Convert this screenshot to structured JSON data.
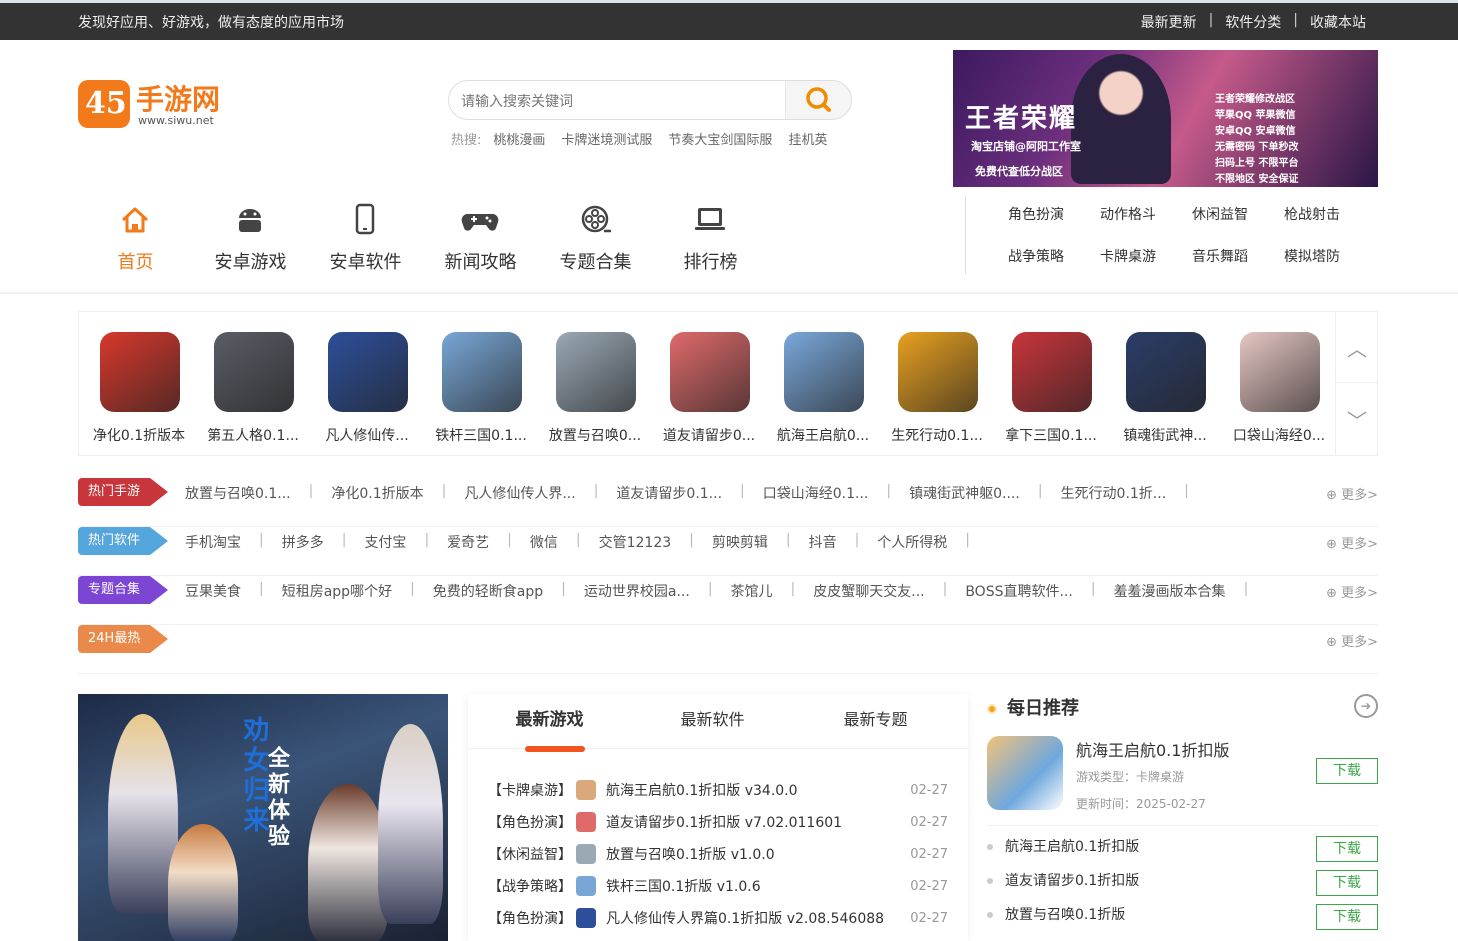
{
  "topbar": {
    "slogan": "发现好应用、好游戏，做有态度的应用市场",
    "links": [
      "最新更新",
      "软件分类",
      "收藏本站"
    ],
    "sep": "|"
  },
  "logo": {
    "mark": "45",
    "name": "手游网",
    "url": "www.siwu.net"
  },
  "search": {
    "placeholder": "请输入搜索关键词",
    "hot_label": "热搜:",
    "hot": [
      "桃桃漫画",
      "卡牌迷境测试服",
      "节奏大宝剑国际服",
      "挂机英"
    ]
  },
  "banner": {
    "title": "王者荣耀",
    "line1": "淘宝店铺@阿阳工作室",
    "line2": "免费代查低分战区",
    "side": [
      "王者荣耀修改战区",
      "苹果QQ 苹果微信",
      "安卓QQ 安卓微信",
      "无需密码 下单秒改",
      "扫码上号 不限平台",
      "不限地区 安全保证"
    ]
  },
  "nav": [
    {
      "label": "首页",
      "icon": "home-icon",
      "glyph": "⌂"
    },
    {
      "label": "安卓游戏",
      "icon": "android-icon",
      "glyph": "◉"
    },
    {
      "label": "安卓软件",
      "icon": "phone-icon",
      "glyph": "▯"
    },
    {
      "label": "新闻攻略",
      "icon": "gamepad-icon",
      "glyph": "◎"
    },
    {
      "label": "专题合集",
      "icon": "film-reel-icon",
      "glyph": "⊛"
    },
    {
      "label": "排行榜",
      "icon": "laptop-icon",
      "glyph": "▭"
    }
  ],
  "categories": [
    "角色扮演",
    "动作格斗",
    "休闲益智",
    "枪战射击",
    "战争策略",
    "卡牌桌游",
    "音乐舞蹈",
    "模拟塔防"
  ],
  "carousel": {
    "apps": [
      {
        "name": "净化0.1折版本",
        "color": "#d8382c"
      },
      {
        "name": "第五人格0.1...",
        "color": "#5a5d66"
      },
      {
        "name": "凡人修仙传...",
        "color": "#2d4f9a"
      },
      {
        "name": "铁杆三国0.1...",
        "color": "#78a7d6"
      },
      {
        "name": "放置与召唤0...",
        "color": "#9aa9b6"
      },
      {
        "name": "道友请留步0...",
        "color": "#e06a6a"
      },
      {
        "name": "航海王启航0...",
        "color": "#7aa8da"
      },
      {
        "name": "生死行动0.1...",
        "color": "#e8a020"
      },
      {
        "name": "拿下三国0.1...",
        "color": "#c9353b"
      },
      {
        "name": "镇魂街武神...",
        "color": "#2b3d68"
      },
      {
        "name": "口袋山海经0...",
        "color": "#e7c7c3"
      }
    ],
    "up": "︿",
    "down": "﹀"
  },
  "rows": [
    {
      "tag": "热门手游",
      "color": "#c8353a",
      "links": [
        "放置与召唤0.1...",
        "净化0.1折版本",
        "凡人修仙传人界...",
        "道友请留步0.1...",
        "口袋山海经0.1...",
        "镇魂街武神躯0....",
        "生死行动0.1折..."
      ]
    },
    {
      "tag": "热门软件",
      "color": "#55a6dd",
      "links": [
        "手机淘宝",
        "拼多多",
        "支付宝",
        "爱奇艺",
        "微信",
        "交管12123",
        "剪映剪辑",
        "抖音",
        "个人所得税"
      ]
    },
    {
      "tag": "专题合集",
      "color": "#7d45d4",
      "links": [
        "豆果美食",
        "短租房app哪个好",
        "免费的轻断食app",
        "运动世界校园a...",
        "茶馆儿",
        "皮皮蟹聊天交友...",
        "BOSS直聘软件...",
        "羞羞漫画版本合集"
      ]
    },
    {
      "tag": "24H最热",
      "color": "#ea8a4a",
      "links": []
    }
  ],
  "more_label": "⊕ 更多>",
  "lower_banner": {
    "title": "劝女归来",
    "subtitle": "全新体验"
  },
  "tabs": [
    "最新游戏",
    "最新软件",
    "最新专题"
  ],
  "latest_games": [
    {
      "cat": "【卡牌桌游】",
      "name": "航海王启航0.1折扣版 v34.0.0",
      "date": "02-27",
      "color": "#d9a97c"
    },
    {
      "cat": "【角色扮演】",
      "name": "道友请留步0.1折扣版 v7.02.011601",
      "date": "02-27",
      "color": "#e06a6a"
    },
    {
      "cat": "【休闲益智】",
      "name": "放置与召唤0.1折版 v1.0.0",
      "date": "02-27",
      "color": "#9aa9b6"
    },
    {
      "cat": "【战争策略】",
      "name": "铁杆三国0.1折版 v1.0.6",
      "date": "02-27",
      "color": "#78a7d6"
    },
    {
      "cat": "【角色扮演】",
      "name": "凡人修仙传人界篇0.1折扣版 v2.08.546088",
      "date": "02-27",
      "color": "#2d4f9a"
    }
  ],
  "daily": {
    "title": "每日推荐",
    "featured": {
      "name": "航海王启航0.1折扣版",
      "type": "游戏类型：卡牌桌游",
      "date": "更新时间：2025-02-27"
    },
    "download_label": "下载",
    "list": [
      "航海王启航0.1折扣版",
      "道友请留步0.1折扣版",
      "放置与召唤0.1折版"
    ]
  }
}
